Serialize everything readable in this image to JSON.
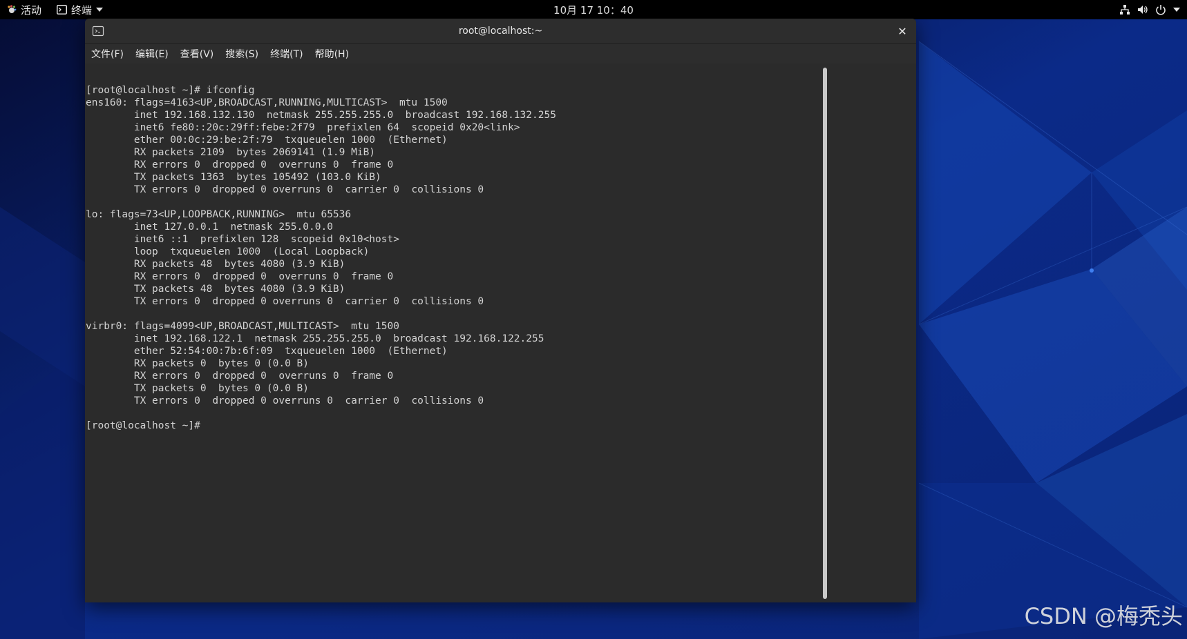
{
  "topbar": {
    "activities_label": "活动",
    "app_menu_label": "终端",
    "clock": "10月 17  10：40",
    "icons": [
      "network-icon",
      "volume-icon",
      "power-icon",
      "chevron-down-icon"
    ]
  },
  "window": {
    "title": "root@localhost:~",
    "close_glyph": "✕"
  },
  "menubar": {
    "items": [
      {
        "label": "文件(F)"
      },
      {
        "label": "编辑(E)"
      },
      {
        "label": "查看(V)"
      },
      {
        "label": "搜索(S)"
      },
      {
        "label": "终端(T)"
      },
      {
        "label": "帮助(H)"
      }
    ]
  },
  "terminal": {
    "lines": [
      "[root@localhost ~]# ifconfig",
      "ens160: flags=4163<UP,BROADCAST,RUNNING,MULTICAST>  mtu 1500",
      "        inet 192.168.132.130  netmask 255.255.255.0  broadcast 192.168.132.255",
      "        inet6 fe80::20c:29ff:febe:2f79  prefixlen 64  scopeid 0x20<link>",
      "        ether 00:0c:29:be:2f:79  txqueuelen 1000  (Ethernet)",
      "        RX packets 2109  bytes 2069141 (1.9 MiB)",
      "        RX errors 0  dropped 0  overruns 0  frame 0",
      "        TX packets 1363  bytes 105492 (103.0 KiB)",
      "        TX errors 0  dropped 0 overruns 0  carrier 0  collisions 0",
      "",
      "lo: flags=73<UP,LOOPBACK,RUNNING>  mtu 65536",
      "        inet 127.0.0.1  netmask 255.0.0.0",
      "        inet6 ::1  prefixlen 128  scopeid 0x10<host>",
      "        loop  txqueuelen 1000  (Local Loopback)",
      "        RX packets 48  bytes 4080 (3.9 KiB)",
      "        RX errors 0  dropped 0  overruns 0  frame 0",
      "        TX packets 48  bytes 4080 (3.9 KiB)",
      "        TX errors 0  dropped 0 overruns 0  carrier 0  collisions 0",
      "",
      "virbr0: flags=4099<UP,BROADCAST,MULTICAST>  mtu 1500",
      "        inet 192.168.122.1  netmask 255.255.255.0  broadcast 192.168.122.255",
      "        ether 52:54:00:7b:6f:09  txqueuelen 1000  (Ethernet)",
      "        RX packets 0  bytes 0 (0.0 B)",
      "        RX errors 0  dropped 0  overruns 0  frame 0",
      "        TX packets 0  bytes 0 (0.0 B)",
      "        TX errors 0  dropped 0 overruns 0  carrier 0  collisions 0",
      "",
      "[root@localhost ~]#"
    ]
  },
  "watermark": "CSDN @梅秃头"
}
